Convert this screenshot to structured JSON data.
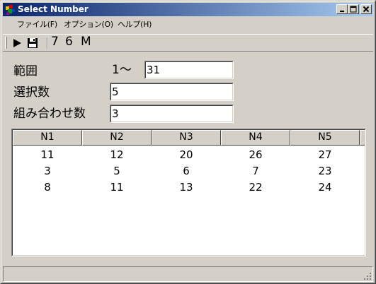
{
  "window": {
    "title": "Select Number",
    "icon": "app-icon",
    "controls": [
      "minimize-icon",
      "maximize-icon",
      "close-icon"
    ]
  },
  "menu": {
    "items": [
      "ファイル(F)",
      "オプション(O)",
      "ヘルプ(H)"
    ]
  },
  "toolbar": {
    "play_icon": "play-icon",
    "save_icon": "save-floppy-icon",
    "buttons": [
      "7",
      "6",
      "M"
    ]
  },
  "form": {
    "range_label": "範囲",
    "range_prefix": "1～",
    "range_value": "31",
    "select_label": "選択数",
    "select_value": "5",
    "combo_label": "組み合わせ数",
    "combo_value": "3"
  },
  "list": {
    "columns": [
      "N1",
      "N2",
      "N3",
      "N4",
      "N5"
    ],
    "rows": [
      [
        "11",
        "12",
        "20",
        "26",
        "27"
      ],
      [
        "3",
        "5",
        "6",
        "7",
        "23"
      ],
      [
        "8",
        "11",
        "13",
        "22",
        "24"
      ]
    ]
  },
  "colors": {
    "title_start": "#0a246a",
    "title_end": "#a6caf0",
    "face": "#d4d0c8"
  }
}
